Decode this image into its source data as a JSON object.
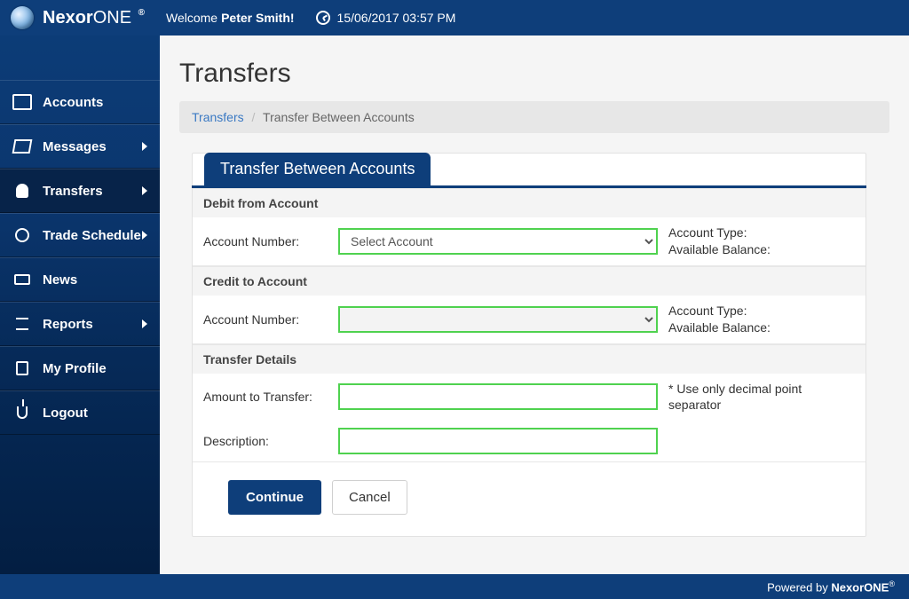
{
  "brand": {
    "part1": "Nexor",
    "part2": "ONE",
    "reg": "®"
  },
  "header": {
    "welcome_prefix": "Welcome",
    "user_name": "Peter Smith!",
    "datetime": "15/06/2017 03:57 PM"
  },
  "sidebar": {
    "items": [
      {
        "label": "Accounts",
        "has_caret": false,
        "active": false,
        "icon": "accounts-icon"
      },
      {
        "label": "Messages",
        "has_caret": true,
        "active": false,
        "icon": "messages-icon"
      },
      {
        "label": "Transfers",
        "has_caret": true,
        "active": true,
        "icon": "transfers-icon"
      },
      {
        "label": "Trade Schedule",
        "has_caret": true,
        "active": false,
        "icon": "trade-schedule-icon"
      },
      {
        "label": "News",
        "has_caret": false,
        "active": false,
        "icon": "news-icon"
      },
      {
        "label": "Reports",
        "has_caret": true,
        "active": false,
        "icon": "reports-icon"
      },
      {
        "label": "My Profile",
        "has_caret": false,
        "active": false,
        "icon": "my-profile-icon"
      },
      {
        "label": "Logout",
        "has_caret": false,
        "active": false,
        "icon": "logout-icon"
      }
    ]
  },
  "page": {
    "title": "Transfers",
    "breadcrumb": {
      "link": "Transfers",
      "current": "Transfer Between Accounts",
      "sep": "/"
    },
    "tab_label": "Transfer Between Accounts"
  },
  "form": {
    "debit": {
      "section_title": "Debit from Account",
      "account_number_label": "Account Number:",
      "select_placeholder": "Select Account",
      "account_type_label": "Account Type:",
      "available_balance_label": "Available Balance:"
    },
    "credit": {
      "section_title": "Credit to Account",
      "account_number_label": "Account Number:",
      "select_placeholder": "",
      "account_type_label": "Account Type:",
      "available_balance_label": "Available Balance:"
    },
    "details": {
      "section_title": "Transfer Details",
      "amount_label": "Amount to Transfer:",
      "amount_hint": "* Use only decimal point separator",
      "description_label": "Description:"
    },
    "buttons": {
      "continue": "Continue",
      "cancel": "Cancel"
    }
  },
  "footer": {
    "text_prefix": "Powered by ",
    "brand": "NexorONE",
    "reg": "®"
  }
}
